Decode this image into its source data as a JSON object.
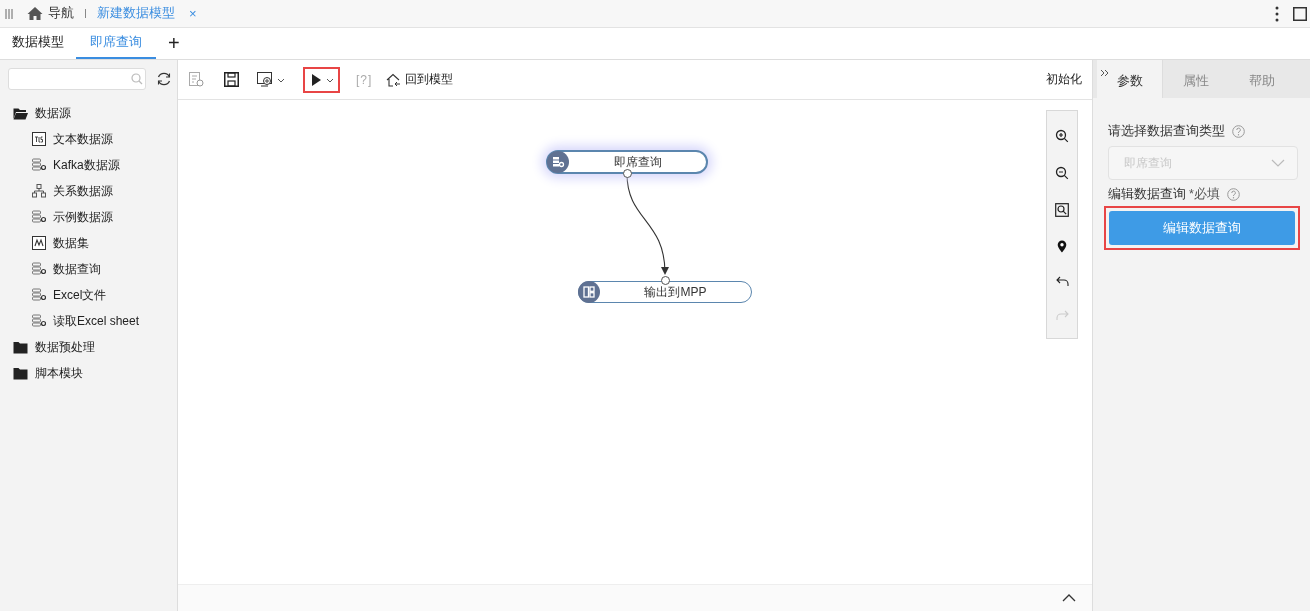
{
  "top_bar": {
    "nav_label": "导航",
    "doc_tabs": [
      {
        "label": "新建数据模型",
        "selected": true,
        "close": "×"
      }
    ]
  },
  "sub_tabs": [
    {
      "label": "数据模型",
      "selected": false
    },
    {
      "label": "即席查询",
      "selected": true
    }
  ],
  "add_tab": "+",
  "tree": [
    {
      "label": "数据源",
      "expanded": true,
      "children": [
        {
          "label": "文本数据源",
          "kind": "text"
        },
        {
          "label": "Kafka数据源",
          "kind": "db"
        },
        {
          "label": "关系数据源",
          "kind": "relation"
        },
        {
          "label": "示例数据源",
          "kind": "db"
        },
        {
          "label": "数据集",
          "kind": "dataset"
        },
        {
          "label": "数据查询",
          "kind": "db"
        },
        {
          "label": "Excel文件",
          "kind": "db"
        },
        {
          "label": "读取Excel sheet",
          "kind": "db"
        }
      ]
    },
    {
      "label": "数据预处理",
      "expanded": false
    },
    {
      "label": "脚本模块",
      "expanded": false
    }
  ],
  "toolbar": {
    "run_highlighted": true,
    "help": "[?]",
    "back_to_model": "回到模型",
    "init": "初始化"
  },
  "canvas": {
    "nodes": [
      {
        "label": "即席查询",
        "kind": "query",
        "selected": true
      },
      {
        "label": "输出到MPP",
        "kind": "output",
        "selected": false
      }
    ]
  },
  "right_panel": {
    "tabs": [
      {
        "label": "参数",
        "selected": true
      },
      {
        "label": "属性",
        "selected": false
      },
      {
        "label": "帮助",
        "selected": false
      }
    ],
    "type_label": "请选择数据查询类型",
    "type_select": {
      "value": "即席查询",
      "disabled": true
    },
    "edit_label": "编辑数据查询",
    "required": "*必填",
    "edit_button": {
      "label": "编辑数据查询",
      "highlighted": true
    }
  }
}
